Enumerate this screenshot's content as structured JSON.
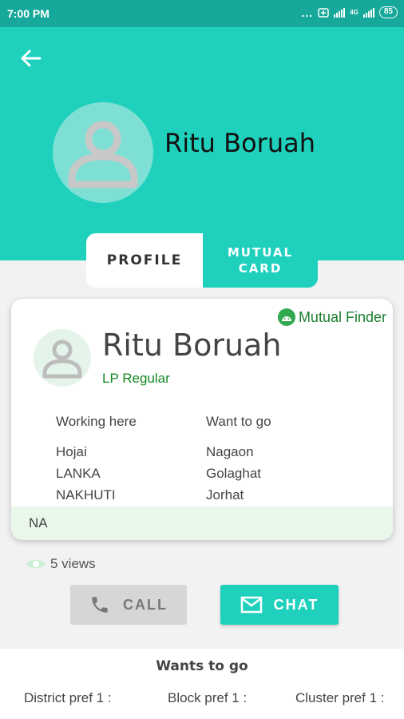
{
  "status_bar": {
    "time": "7:00 PM",
    "dots": "...",
    "network": "4G",
    "battery": "85"
  },
  "header": {
    "name": "Ritu Boruah"
  },
  "tabs": [
    {
      "label": "PROFILE",
      "active": true
    },
    {
      "label": "MUTUAL CARD",
      "active": false
    }
  ],
  "card": {
    "badge": "Mutual Finder",
    "name": "Ritu Boruah",
    "role": "LP Regular",
    "working_header": "Working here",
    "working": [
      "Hojai",
      "LANKA",
      "NAKHUTI"
    ],
    "want_header": "Want to go",
    "want": [
      "Nagaon",
      "Golaghat",
      "Jorhat"
    ],
    "footer": "NA"
  },
  "views": "5 views",
  "buttons": {
    "call": "CALL",
    "chat": "CHAT"
  },
  "bottom": {
    "title": "Wants to go",
    "prefs": [
      "District pref 1 :",
      "Block pref 1 :",
      "Cluster pref 1 :"
    ]
  },
  "colors": {
    "accent": "#1fd1bd",
    "status_bar": "#16a89a",
    "green": "#138a24"
  },
  "icons": [
    "back-arrow-icon",
    "avatar-icon",
    "android-icon",
    "eye-icon",
    "phone-icon",
    "mail-icon"
  ]
}
